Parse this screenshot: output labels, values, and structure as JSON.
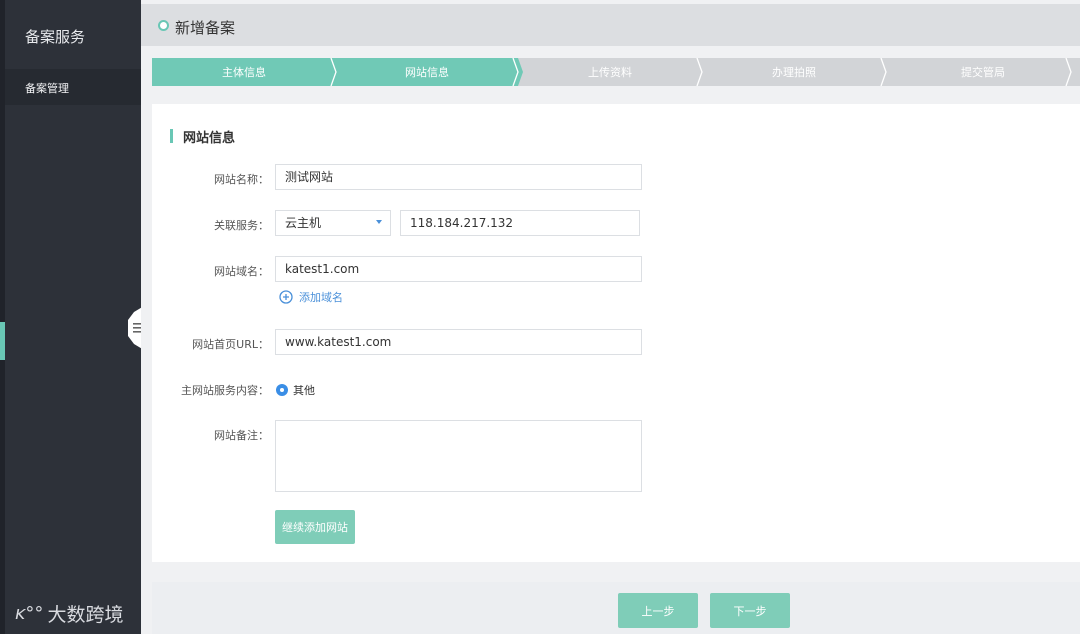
{
  "sidebar": {
    "title": "备案服务",
    "items": [
      {
        "label": "备案管理"
      }
    ]
  },
  "watermark": {
    "logo": "ᴋ°°",
    "text": "大数跨境"
  },
  "header": {
    "title": "新增备案"
  },
  "steps": [
    {
      "label": "主体信息",
      "state": "done"
    },
    {
      "label": "网站信息",
      "state": "current"
    },
    {
      "label": "上传资料",
      "state": "todo"
    },
    {
      "label": "办理拍照",
      "state": "todo"
    },
    {
      "label": "提交管局",
      "state": "todo"
    }
  ],
  "form": {
    "section_title": "网站信息",
    "site_name": {
      "label": "网站名称：",
      "value": "测试网站"
    },
    "service": {
      "label": "关联服务：",
      "type_value": "云主机",
      "ip_value": "118.184.217.132"
    },
    "domain": {
      "label": "网站域名：",
      "value": "katest1.com",
      "add_label": "添加域名"
    },
    "home_url": {
      "label": "网站首页URL：",
      "value": "www.katest1.com"
    },
    "content": {
      "label": "主网站服务内容：",
      "option": "其他"
    },
    "remark": {
      "label": "网站备注：",
      "value": ""
    },
    "add_site_button": "继续添加网站"
  },
  "footer": {
    "prev_label": "上一步",
    "next_label": "下一步"
  },
  "colors": {
    "accent": "#69c7b5",
    "sidebar": "#2d3139",
    "link": "#4a90d9"
  },
  "icons": {
    "header": "circle-icon",
    "add": "plus-circle-icon",
    "dropdown": "caret-down-icon",
    "toggle": "menu-icon"
  }
}
